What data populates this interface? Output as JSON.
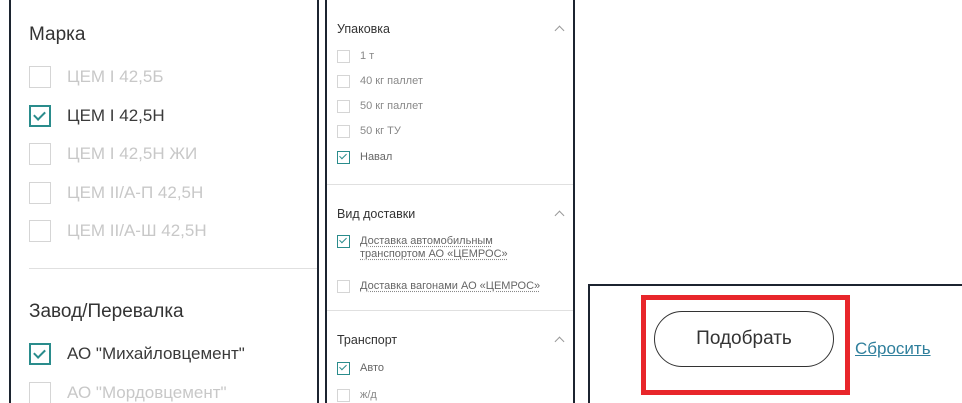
{
  "brand": {
    "title": "Марка",
    "items": [
      {
        "label": "ЦЕМ I 42,5Б",
        "checked": false
      },
      {
        "label": "ЦЕМ I 42,5Н",
        "checked": true
      },
      {
        "label": "ЦЕМ I 42,5Н ЖИ",
        "checked": false
      },
      {
        "label": "ЦЕМ II/А-П 42,5Н",
        "checked": false
      },
      {
        "label": "ЦЕМ II/А-Ш 42,5Н",
        "checked": false
      }
    ]
  },
  "plant": {
    "title": "Завод/Перевалка",
    "items": [
      {
        "label": "АО \"Михайловцемент\"",
        "checked": true
      },
      {
        "label": "АО \"Мордовцемент\"",
        "checked": false
      }
    ]
  },
  "packaging": {
    "title": "Упаковка",
    "items": [
      {
        "label": "1 т",
        "checked": false
      },
      {
        "label": "40 кг паллет",
        "checked": false
      },
      {
        "label": "50 кг паллет",
        "checked": false
      },
      {
        "label": "50 кг ТУ",
        "checked": false
      },
      {
        "label": "Навал",
        "checked": true
      }
    ]
  },
  "delivery": {
    "title": "Вид доставки",
    "items": [
      {
        "label_line1": "Доставка автомобильным",
        "label_line2": "транспортом АО «ЦЕМРОС»",
        "checked": true
      },
      {
        "label_line1": "Доставка вагонами АО «ЦЕМРОС»",
        "checked": false
      }
    ]
  },
  "transport": {
    "title": "Транспорт",
    "items": [
      {
        "label": "Авто",
        "checked": true
      },
      {
        "label": "ж/д",
        "checked": false
      }
    ]
  },
  "actions": {
    "pick_label": "Подобрать",
    "reset_label": "Сбросить"
  },
  "colors": {
    "accent": "#2a8c8c",
    "highlight": "#e8262b",
    "link": "#2f7f9c"
  }
}
